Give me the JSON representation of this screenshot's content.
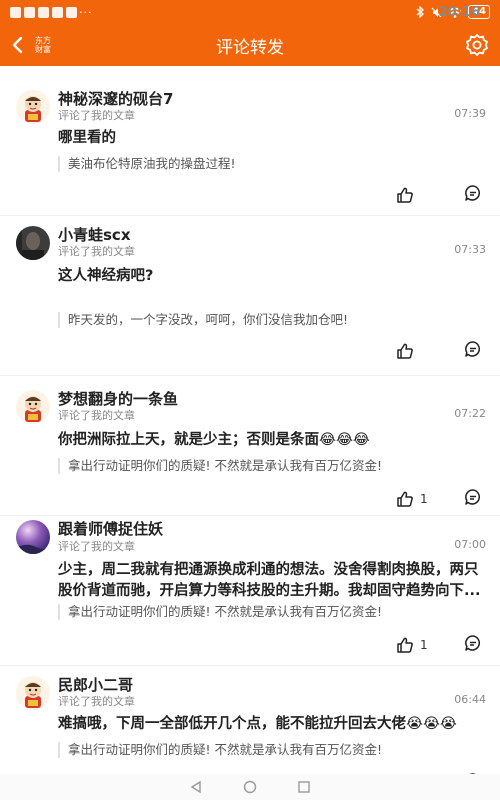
{
  "status_bar": {
    "time": "20:16",
    "more": "···",
    "battery": "44"
  },
  "header": {
    "logo_line1": "东方",
    "logo_line2": "财富",
    "title": "评论转发"
  },
  "items": [
    {
      "name": "神秘深邃的砚台7",
      "sub": "评论了我的文章",
      "time": "07:39",
      "comment": "哪里看的",
      "quote": "美油布伦特原油我的操盘过程!",
      "likes": "",
      "avatar": "cartoon"
    },
    {
      "name": "小青蛙scx",
      "sub": "评论了我的文章",
      "time": "07:33",
      "comment": "这人神经病吧?",
      "quote": "昨天发的，一个字没改，呵呵，你们没信我加仓吧!",
      "likes": "",
      "avatar": "photo-dark"
    },
    {
      "name": "梦想翻身的一条鱼",
      "sub": "评论了我的文章",
      "time": "07:22",
      "comment": "你把洲际拉上天，就是少主；否则是条面😂😂😂",
      "quote": "拿出行动证明你们的质疑! 不然就是承认我有百万亿资金!",
      "likes": "1",
      "avatar": "cartoon"
    },
    {
      "name": "跟着师傅捉住妖",
      "sub": "评论了我的文章",
      "time": "07:00",
      "comment": "少主，周二我就有把通源换成利通的想法。没舍得割肉换股，两只股价背道而驰，开启算力等科技股的主升期。我却固守趋势向下...",
      "quote": "拿出行动证明你们的质疑! 不然就是承认我有百万亿资金!",
      "likes": "1",
      "avatar": "photo-purple"
    },
    {
      "name": "民郎小二哥",
      "sub": "评论了我的文章",
      "time": "06:44",
      "comment": "难搞哦，下周一全部低开几个点，能不能拉升回去大佬😭😭😭",
      "quote": "拿出行动证明你们的质疑! 不然就是承认我有百万亿资金!",
      "likes": "",
      "avatar": "cartoon"
    }
  ],
  "colors": {
    "accent": "#f2650a"
  }
}
